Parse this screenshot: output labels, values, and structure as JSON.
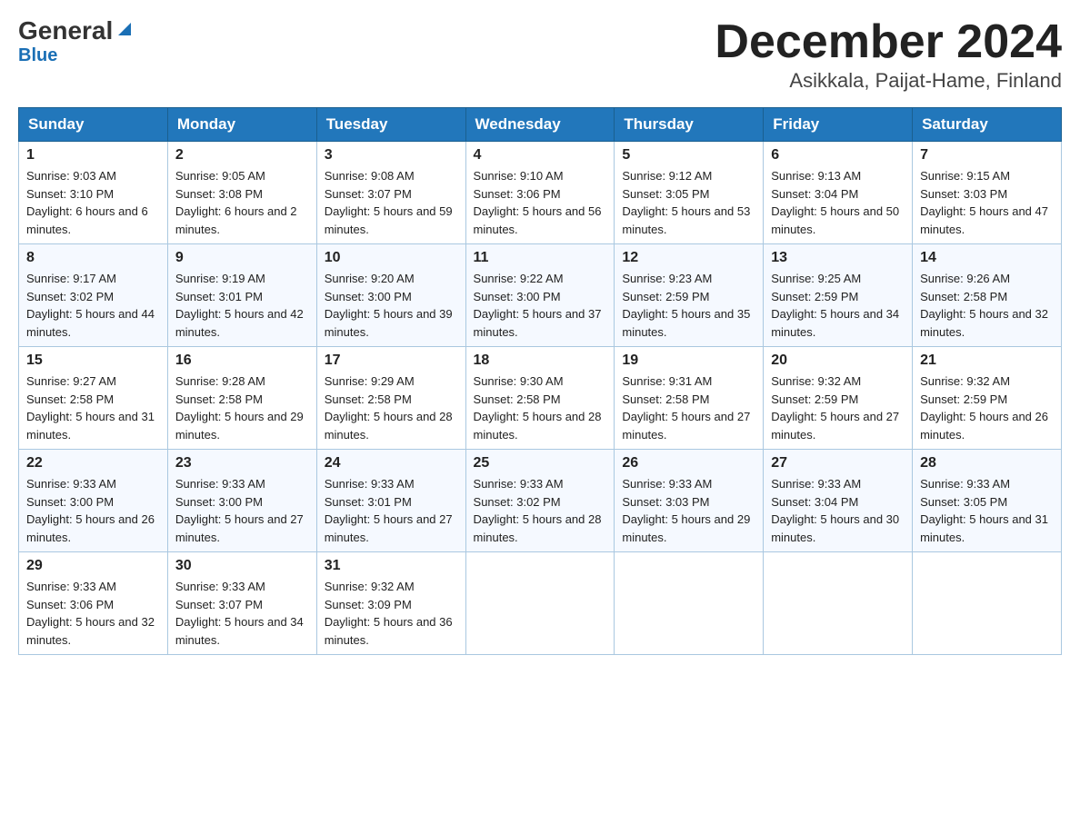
{
  "header": {
    "logo_general": "General",
    "logo_blue": "Blue",
    "month_title": "December 2024",
    "location": "Asikkala, Paijat-Hame, Finland"
  },
  "columns": [
    "Sunday",
    "Monday",
    "Tuesday",
    "Wednesday",
    "Thursday",
    "Friday",
    "Saturday"
  ],
  "weeks": [
    [
      {
        "day": "1",
        "sunrise": "9:03 AM",
        "sunset": "3:10 PM",
        "daylight": "6 hours and 6 minutes."
      },
      {
        "day": "2",
        "sunrise": "9:05 AM",
        "sunset": "3:08 PM",
        "daylight": "6 hours and 2 minutes."
      },
      {
        "day": "3",
        "sunrise": "9:08 AM",
        "sunset": "3:07 PM",
        "daylight": "5 hours and 59 minutes."
      },
      {
        "day": "4",
        "sunrise": "9:10 AM",
        "sunset": "3:06 PM",
        "daylight": "5 hours and 56 minutes."
      },
      {
        "day": "5",
        "sunrise": "9:12 AM",
        "sunset": "3:05 PM",
        "daylight": "5 hours and 53 minutes."
      },
      {
        "day": "6",
        "sunrise": "9:13 AM",
        "sunset": "3:04 PM",
        "daylight": "5 hours and 50 minutes."
      },
      {
        "day": "7",
        "sunrise": "9:15 AM",
        "sunset": "3:03 PM",
        "daylight": "5 hours and 47 minutes."
      }
    ],
    [
      {
        "day": "8",
        "sunrise": "9:17 AM",
        "sunset": "3:02 PM",
        "daylight": "5 hours and 44 minutes."
      },
      {
        "day": "9",
        "sunrise": "9:19 AM",
        "sunset": "3:01 PM",
        "daylight": "5 hours and 42 minutes."
      },
      {
        "day": "10",
        "sunrise": "9:20 AM",
        "sunset": "3:00 PM",
        "daylight": "5 hours and 39 minutes."
      },
      {
        "day": "11",
        "sunrise": "9:22 AM",
        "sunset": "3:00 PM",
        "daylight": "5 hours and 37 minutes."
      },
      {
        "day": "12",
        "sunrise": "9:23 AM",
        "sunset": "2:59 PM",
        "daylight": "5 hours and 35 minutes."
      },
      {
        "day": "13",
        "sunrise": "9:25 AM",
        "sunset": "2:59 PM",
        "daylight": "5 hours and 34 minutes."
      },
      {
        "day": "14",
        "sunrise": "9:26 AM",
        "sunset": "2:58 PM",
        "daylight": "5 hours and 32 minutes."
      }
    ],
    [
      {
        "day": "15",
        "sunrise": "9:27 AM",
        "sunset": "2:58 PM",
        "daylight": "5 hours and 31 minutes."
      },
      {
        "day": "16",
        "sunrise": "9:28 AM",
        "sunset": "2:58 PM",
        "daylight": "5 hours and 29 minutes."
      },
      {
        "day": "17",
        "sunrise": "9:29 AM",
        "sunset": "2:58 PM",
        "daylight": "5 hours and 28 minutes."
      },
      {
        "day": "18",
        "sunrise": "9:30 AM",
        "sunset": "2:58 PM",
        "daylight": "5 hours and 28 minutes."
      },
      {
        "day": "19",
        "sunrise": "9:31 AM",
        "sunset": "2:58 PM",
        "daylight": "5 hours and 27 minutes."
      },
      {
        "day": "20",
        "sunrise": "9:32 AM",
        "sunset": "2:59 PM",
        "daylight": "5 hours and 27 minutes."
      },
      {
        "day": "21",
        "sunrise": "9:32 AM",
        "sunset": "2:59 PM",
        "daylight": "5 hours and 26 minutes."
      }
    ],
    [
      {
        "day": "22",
        "sunrise": "9:33 AM",
        "sunset": "3:00 PM",
        "daylight": "5 hours and 26 minutes."
      },
      {
        "day": "23",
        "sunrise": "9:33 AM",
        "sunset": "3:00 PM",
        "daylight": "5 hours and 27 minutes."
      },
      {
        "day": "24",
        "sunrise": "9:33 AM",
        "sunset": "3:01 PM",
        "daylight": "5 hours and 27 minutes."
      },
      {
        "day": "25",
        "sunrise": "9:33 AM",
        "sunset": "3:02 PM",
        "daylight": "5 hours and 28 minutes."
      },
      {
        "day": "26",
        "sunrise": "9:33 AM",
        "sunset": "3:03 PM",
        "daylight": "5 hours and 29 minutes."
      },
      {
        "day": "27",
        "sunrise": "9:33 AM",
        "sunset": "3:04 PM",
        "daylight": "5 hours and 30 minutes."
      },
      {
        "day": "28",
        "sunrise": "9:33 AM",
        "sunset": "3:05 PM",
        "daylight": "5 hours and 31 minutes."
      }
    ],
    [
      {
        "day": "29",
        "sunrise": "9:33 AM",
        "sunset": "3:06 PM",
        "daylight": "5 hours and 32 minutes."
      },
      {
        "day": "30",
        "sunrise": "9:33 AM",
        "sunset": "3:07 PM",
        "daylight": "5 hours and 34 minutes."
      },
      {
        "day": "31",
        "sunrise": "9:32 AM",
        "sunset": "3:09 PM",
        "daylight": "5 hours and 36 minutes."
      },
      null,
      null,
      null,
      null
    ]
  ]
}
